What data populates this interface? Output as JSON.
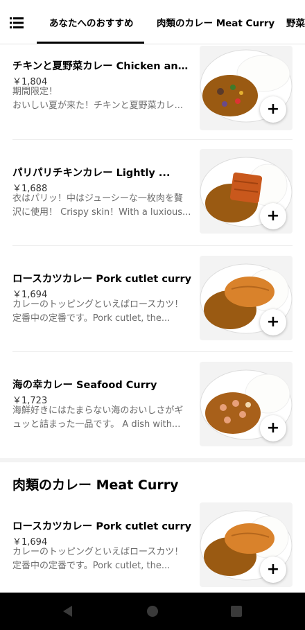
{
  "nav_tabs": [
    "あなたへのおすすめ",
    "肉類のカレー Meat Curry",
    "野菜"
  ],
  "items": [
    {
      "name": "チキンと夏野菜カレー Chicken and ...",
      "price": "￥1,804",
      "desc1": "期間限定！",
      "desc2": "おいしい夏が来た！チキンと夏野菜カレ...",
      "image": "chicken-vegetable-curry-photo"
    },
    {
      "name": "パリパリチキンカレー Lightly ...",
      "price": "￥1,688",
      "desc1": "衣はパリッ！中はジューシーな一枚肉を贅",
      "desc2": "沢に使用！ Crispy skin！With a luxious...",
      "image": "crispy-chicken-curry-photo"
    },
    {
      "name": "ロースカツカレー Pork cutlet curry",
      "price": "￥1,694",
      "desc1": "カレーのトッピングといえばロースカツ！",
      "desc2": "定番中の定番です。Pork cutlet, the...",
      "image": "pork-cutlet-curry-photo"
    },
    {
      "name": "海の幸カレー Seafood Curry",
      "price": "￥1,723",
      "desc1": "海鮮好きにはたまらない海のおいしさがギ",
      "desc2": "ュッと詰まった一品です。 A dish with...",
      "image": "seafood-curry-photo"
    }
  ],
  "section": {
    "title": "肉類のカレー Meat Curry",
    "items": [
      {
        "name": "ロースカツカレー Pork cutlet curry",
        "price": "￥1,694",
        "desc1": "カレーのトッピングといえばロースカツ！",
        "desc2": "定番中の定番です。Pork cutlet, the...",
        "image": "pork-cutlet-curry-photo"
      }
    ]
  },
  "add_label": "+",
  "icons": {
    "menu": "list-menu-icon",
    "add": "plus-icon",
    "back": "back-triangle-icon",
    "home": "home-circle-icon",
    "recent": "recent-square-icon"
  },
  "colors": {
    "curry": "#9a5a12",
    "rice": "#ffffff",
    "cutlet": "#d9822b",
    "nav_bar": "#000000"
  }
}
